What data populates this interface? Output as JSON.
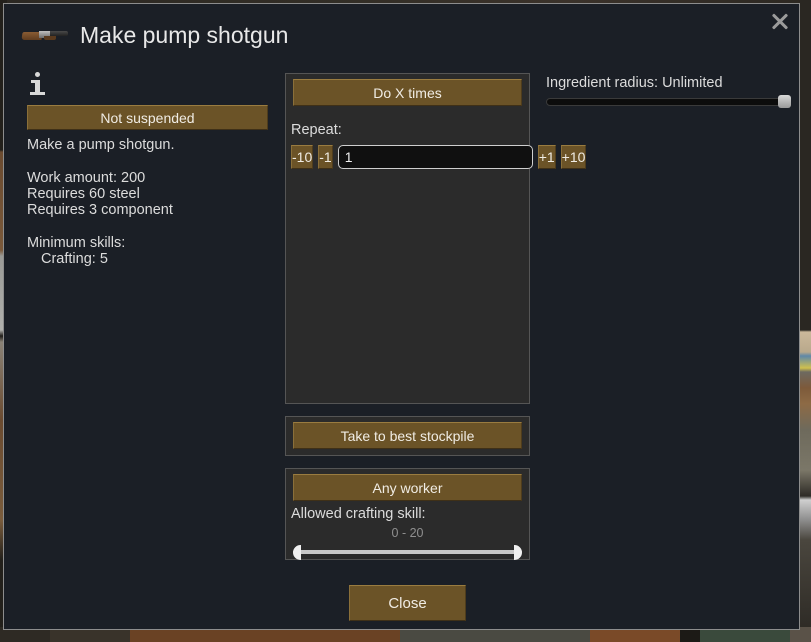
{
  "window": {
    "title": "Make pump shotgun",
    "title_icon": "shotgun-icon",
    "close_icon": "close-x-icon",
    "info_icon": "info-icon"
  },
  "left": {
    "suspend_toggle_label": "Not suspended",
    "description": "Make a pump shotgun.",
    "stats": [
      "Work amount: 200",
      "Requires 60 steel",
      "Requires 3 component"
    ],
    "skills_heading": "Minimum skills:",
    "skills": [
      "Crafting: 5"
    ]
  },
  "repeat": {
    "mode_label": "Do X times",
    "repeat_label": "Repeat:",
    "minus_ten_label": "-10",
    "minus_one_label": "-1",
    "count_value": "1",
    "plus_one_label": "+1",
    "plus_ten_label": "+10"
  },
  "stockpile": {
    "button_label": "Take to best stockpile"
  },
  "worker": {
    "button_label": "Any worker",
    "skill_label": "Allowed crafting skill:",
    "skill_range_text": "0 - 20",
    "skill_min": 0,
    "skill_max": 20
  },
  "ingredients": {
    "radius_label": "Ingredient radius: Unlimited",
    "radius_value": "Unlimited"
  },
  "footer": {
    "close_label": "Close"
  },
  "colors": {
    "dialog_background": "#1b1f26",
    "dialog_border": "#8d8d8d",
    "panel_background": "#2b2b2b",
    "panel_border": "#555555",
    "button_brown": "#6b5327",
    "button_brown_highlight": "#9a7c40",
    "text_primary": "#e3e3e3",
    "text_muted": "#8f8f8f",
    "slider_track": "#c9c9c9"
  }
}
